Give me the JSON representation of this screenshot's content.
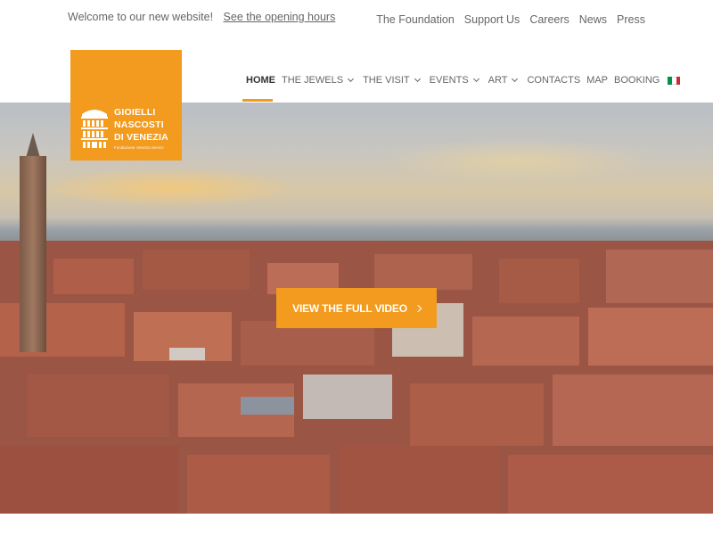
{
  "topbar": {
    "welcome_text": "Welcome to our new website!",
    "opening_hours_link": "See the opening hours",
    "links": [
      "The Foundation",
      "Support Us",
      "Careers",
      "News",
      "Press"
    ]
  },
  "logo": {
    "line1": "GIOIELLI",
    "line2": "NASCOSTI",
    "line3": "DI VENEZIA",
    "subtitle": "Fondazione Venezia Servizi",
    "bg_color": "#f29b1e",
    "icon": "building-facade-icon"
  },
  "nav": {
    "items": [
      {
        "label": "HOME",
        "active": true,
        "dropdown": false
      },
      {
        "label": "THE JEWELS",
        "active": false,
        "dropdown": true
      },
      {
        "label": "THE VISIT",
        "active": false,
        "dropdown": true
      },
      {
        "label": "EVENTS",
        "active": false,
        "dropdown": true
      },
      {
        "label": "ART",
        "active": false,
        "dropdown": true
      },
      {
        "label": "CONTACTS",
        "active": false,
        "dropdown": false
      },
      {
        "label": "MAP",
        "active": false,
        "dropdown": false
      },
      {
        "label": "BOOKING",
        "active": false,
        "dropdown": false
      }
    ],
    "language_flag": "italian-flag-icon"
  },
  "hero": {
    "cta_label": "VIEW THE FULL VIDEO",
    "cta_icon": "chevron-right-icon",
    "accent_color": "#f29b1e"
  }
}
